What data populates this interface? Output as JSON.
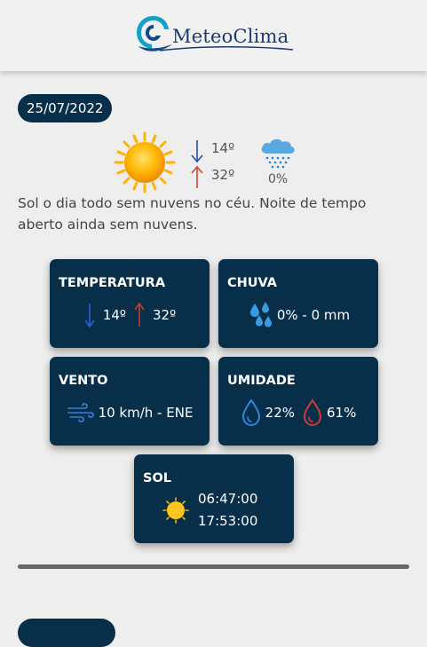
{
  "brand": {
    "name": "MeteoClima"
  },
  "forecast": {
    "date": "25/07/2022",
    "temp_min": "14º",
    "temp_max": "32º",
    "rain_chance": "0%",
    "description": "Sol o dia todo sem nuvens no céu. Noite de tempo aberto ainda sem nuvens.",
    "weather_icon": "sun-icon"
  },
  "cards": {
    "temperature": {
      "title": "TEMPERATURA",
      "min": "14º",
      "max": "32º"
    },
    "rain": {
      "title": "CHUVA",
      "value": "0% - 0 mm"
    },
    "wind": {
      "title": "VENTO",
      "value": "10 km/h - ENE"
    },
    "humidity": {
      "title": "UMIDADE",
      "min": "22%",
      "max": "61%"
    },
    "sun": {
      "title": "SOL",
      "sunrise": "06:47:00",
      "sunset": "17:53:00"
    }
  },
  "colors": {
    "card_bg": "#072f49",
    "arrow_min": "#1f4fb0",
    "arrow_max": "#d2472b",
    "drop_min": "#2e88d8",
    "drop_max": "#d23a3a"
  }
}
